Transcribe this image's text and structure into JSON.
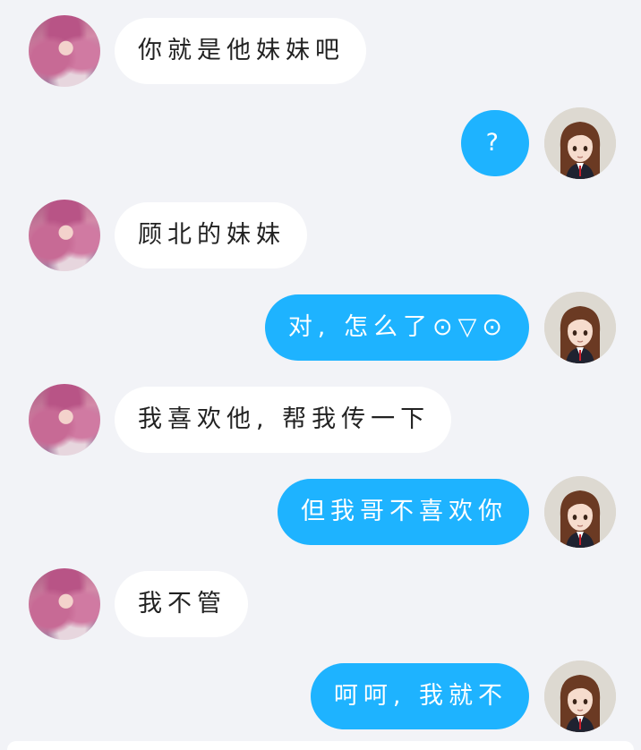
{
  "messages": [
    {
      "side": "left",
      "text": "你就是他妹妹吧"
    },
    {
      "side": "right",
      "text": "?"
    },
    {
      "side": "left",
      "text": "顾北的妹妹"
    },
    {
      "side": "right",
      "text": "对, 怎么了⊙▽⊙"
    },
    {
      "side": "left",
      "text": "我喜欢他, 帮我传一下"
    },
    {
      "side": "right",
      "text": "但我哥不喜欢你"
    },
    {
      "side": "left",
      "text": "我不管"
    },
    {
      "side": "right",
      "text": "呵呵, 我就不"
    }
  ],
  "colors": {
    "background": "#f2f3f7",
    "incoming_bubble": "#ffffff",
    "outgoing_bubble": "#1eb3ff",
    "outgoing_text": "#ffffff",
    "incoming_text": "#222222"
  },
  "icons": {
    "left_avatar": "pink-haired-girl-avatar",
    "right_avatar": "brown-haired-girl-avatar"
  }
}
